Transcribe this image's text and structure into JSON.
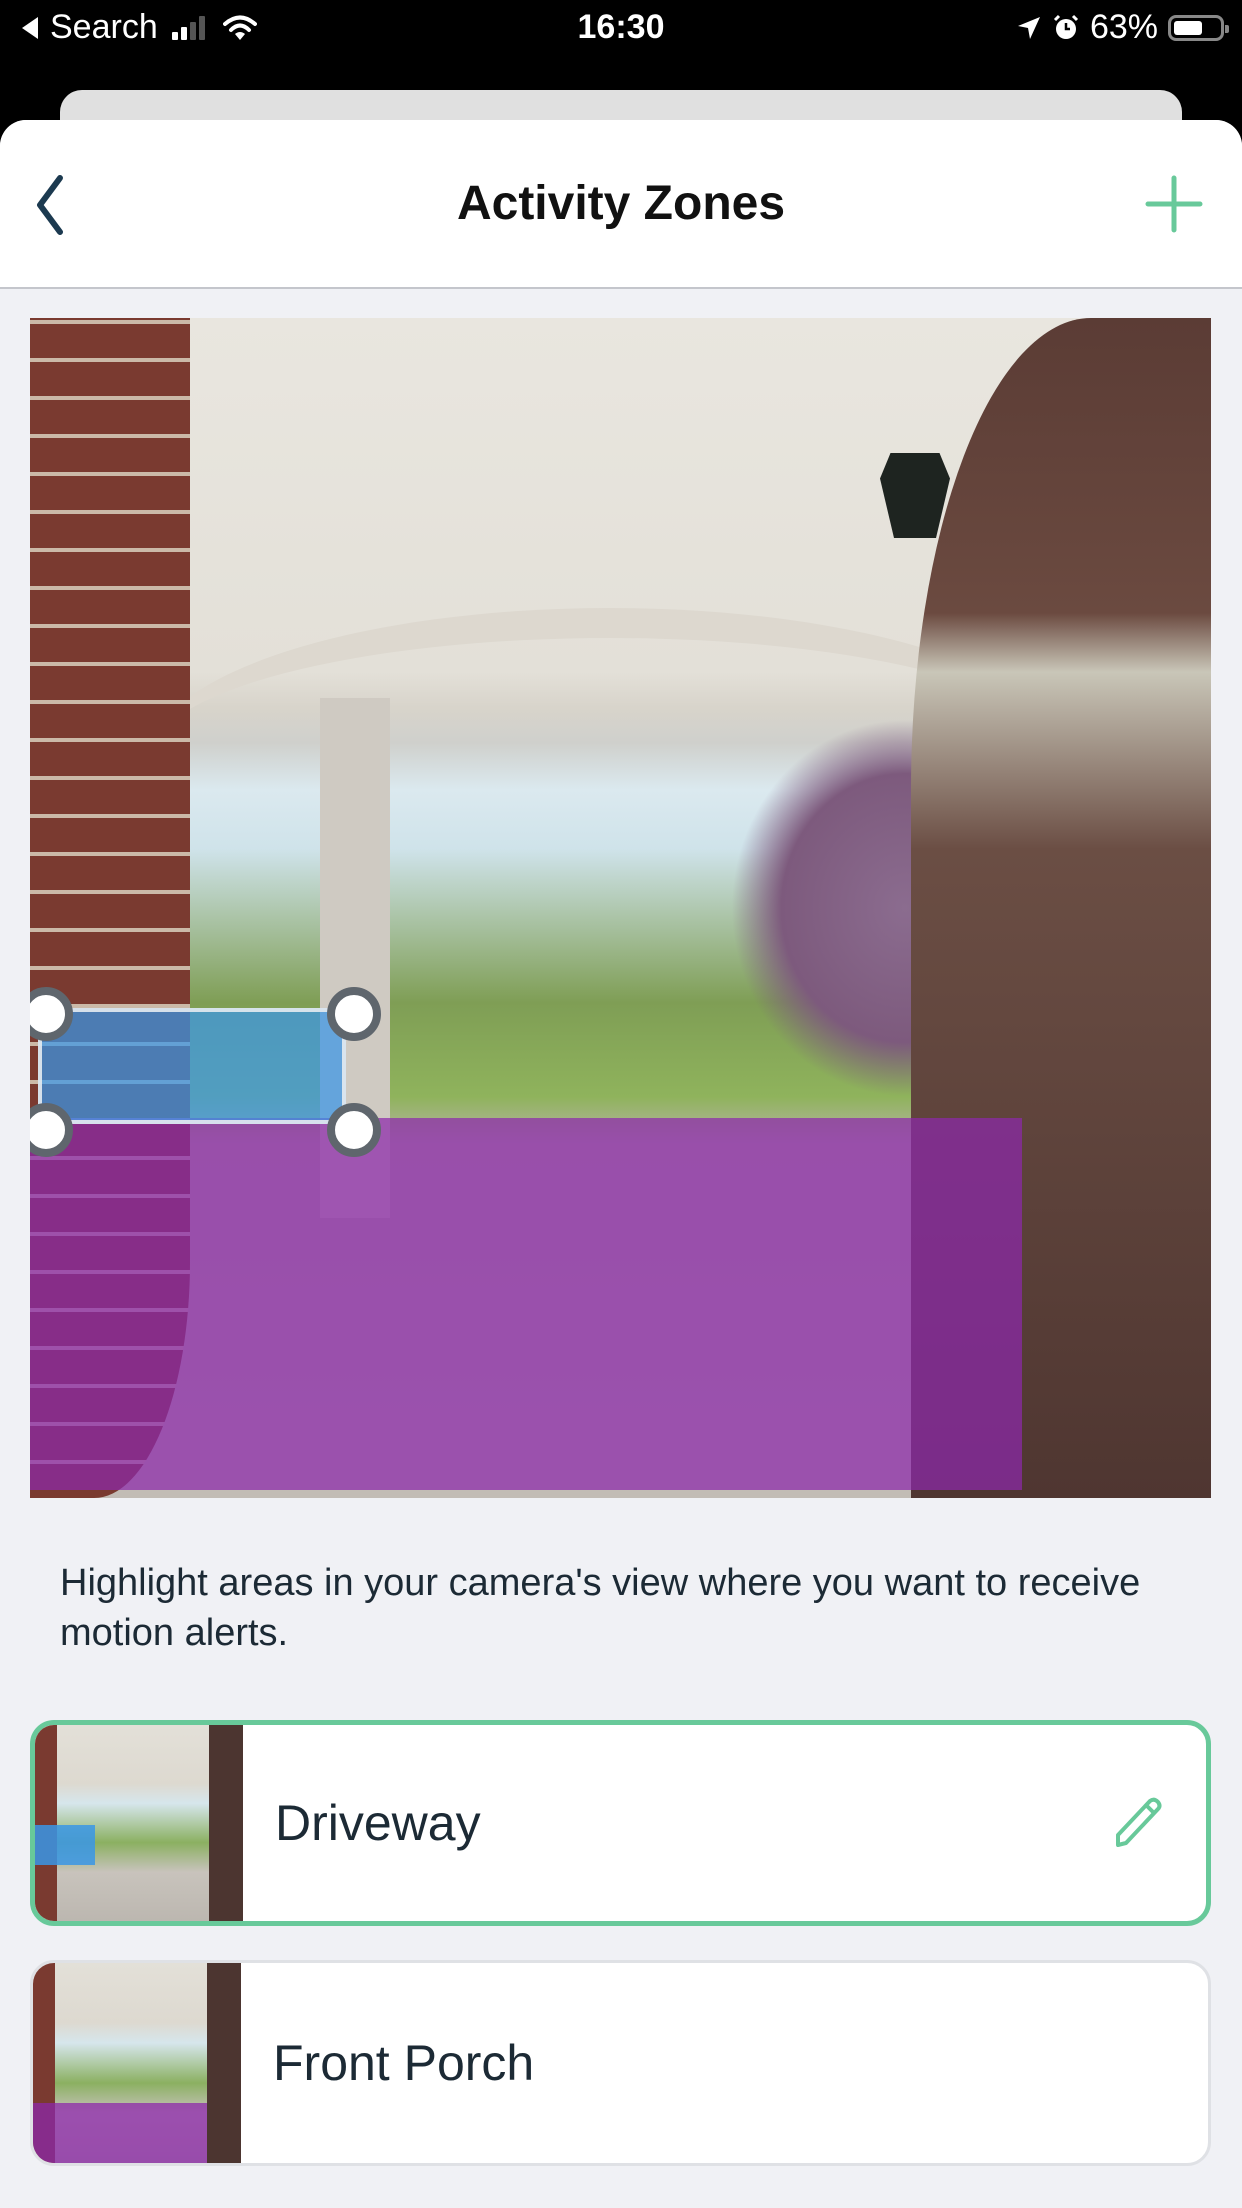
{
  "status_bar": {
    "back_app": "Search",
    "time": "16:30",
    "battery_percent": "63%",
    "battery_level": 0.63,
    "signal_bars_active": 2,
    "signal_bars_total": 4,
    "icons": [
      "back-triangle-icon",
      "signal-icon",
      "wifi-icon",
      "location-arrow-icon",
      "alarm-icon",
      "battery-icon"
    ]
  },
  "header": {
    "title": "Activity Zones",
    "back_icon": "chevron-left-icon",
    "add_icon": "plus-icon"
  },
  "camera_view": {
    "zones": [
      {
        "name": "Driveway",
        "color": "#3a96e6",
        "selected": true
      },
      {
        "name": "Front Porch",
        "color": "#8c28aa",
        "selected": false
      }
    ]
  },
  "description": "Highlight areas in your camera's view where you want to receive motion alerts.",
  "zones": [
    {
      "name": "Driveway",
      "selected": true,
      "edit_icon": "pencil-icon"
    },
    {
      "name": "Front Porch",
      "selected": false
    }
  ],
  "colors": {
    "accent": "#68c99a",
    "nav_icon": "#1c3a50",
    "text": "#1c2a35",
    "background": "#f0f1f5"
  }
}
